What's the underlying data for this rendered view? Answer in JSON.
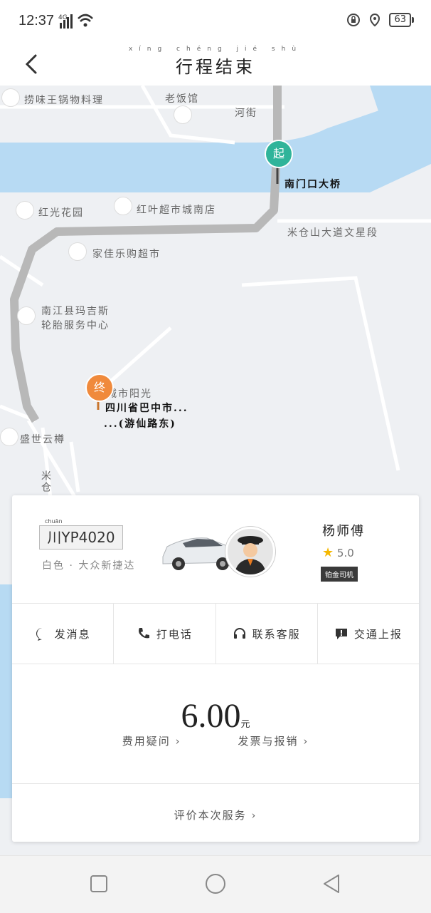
{
  "status": {
    "time": "12:37",
    "network": "4G",
    "battery": "63"
  },
  "header": {
    "title": "行程结束",
    "pinyin": "xíng chéng jié shù"
  },
  "map": {
    "labels": [
      {
        "text": "捞味王锅物料理"
      },
      {
        "text": "老饭馆"
      },
      {
        "text": "河街"
      },
      {
        "text": "南门口大桥"
      },
      {
        "text": "红光花园"
      },
      {
        "text": "红叶超市城南店"
      },
      {
        "text": "米仓山大道文星段"
      },
      {
        "text": "家佳乐购超市"
      },
      {
        "text": "南江县玛吉斯"
      },
      {
        "text": "轮胎服务中心"
      },
      {
        "text": "城市阳光"
      },
      {
        "text": "四川省巴中市..."
      },
      {
        "text": "...(游仙路东)"
      },
      {
        "text": "盛世云樽"
      },
      {
        "text": "米仓"
      }
    ],
    "start_marker": "起",
    "end_marker": "终",
    "colors": {
      "start": "#2fb49a",
      "end": "#f08a3c",
      "route": "#b8b8b8",
      "water": "#b7daf3"
    }
  },
  "card": {
    "plate_province_pinyin": "chuān",
    "plate": "川YP4020",
    "car_info": "白色 · 大众新捷达",
    "driver_name": "杨师傅",
    "rating": "5.0",
    "badge": "铂金司机",
    "actions": [
      {
        "label": "发消息",
        "icon": "message-icon"
      },
      {
        "label": "打电话",
        "icon": "phone-icon"
      },
      {
        "label": "联系客服",
        "icon": "headset-icon"
      },
      {
        "label": "交通上报",
        "icon": "report-icon"
      }
    ],
    "price": "6.00",
    "price_unit": "元",
    "fee_question": "费用疑问",
    "invoice": "发票与报销",
    "rate_service": "评价本次服务"
  }
}
